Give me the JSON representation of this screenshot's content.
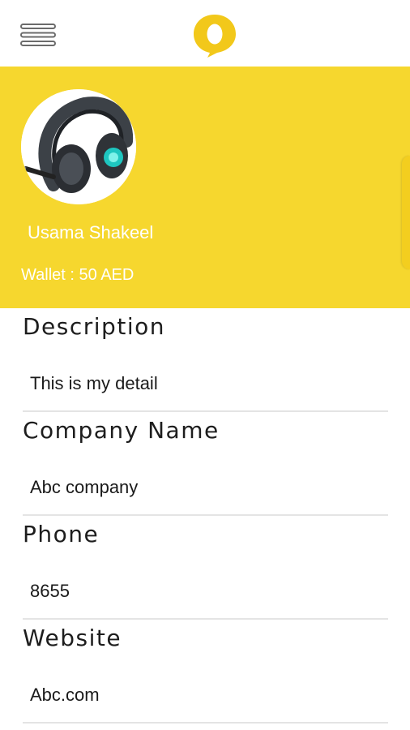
{
  "icons": {
    "menu": "hamburger-menu-icon",
    "logo": "app-logo-icon"
  },
  "colors": {
    "brand_yellow": "#f6d72e",
    "text_white": "#ffffff",
    "divider": "#e4e4e4"
  },
  "profile": {
    "name": "Usama Shakeel",
    "wallet": "Wallet : 50 AED"
  },
  "details": [
    {
      "label": "Description",
      "value": "This is my detail"
    },
    {
      "label": "Company Name",
      "value": "Abc company"
    },
    {
      "label": "Phone",
      "value": "8655"
    },
    {
      "label": "Website",
      "value": "Abc.com"
    }
  ]
}
